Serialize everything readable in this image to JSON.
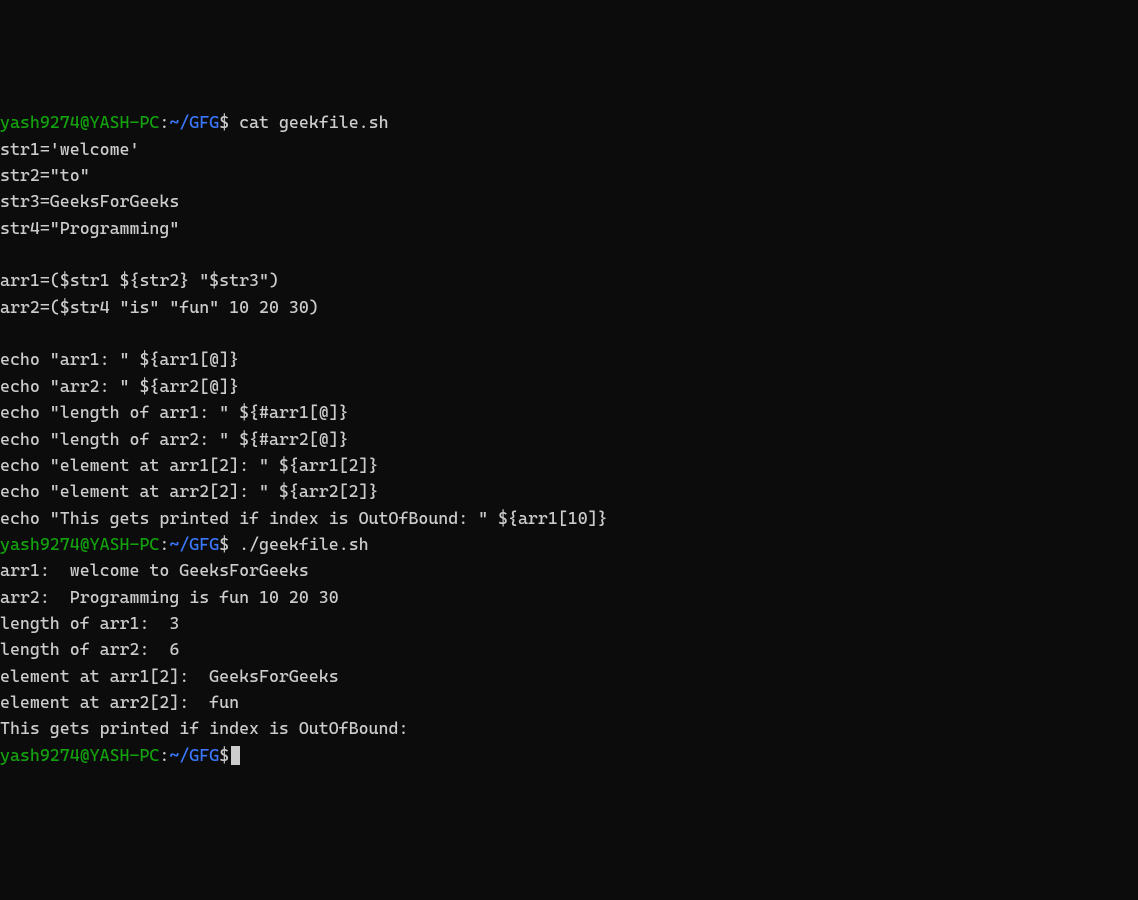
{
  "prompt": {
    "user": "yash9274",
    "at": "@",
    "host": "YASH-PC",
    "colon": ":",
    "tilde": "~",
    "slash": "/",
    "dir": "GFG",
    "dollar": "$"
  },
  "cmd1": "cat geekfile.sh",
  "file": {
    "l1": "str1='welcome'",
    "l2": "str2=\"to\"",
    "l3": "str3=GeeksForGeeks",
    "l4": "str4=\"Programming\"",
    "l5": "",
    "l6": "arr1=($str1 ${str2} \"$str3\")",
    "l7": "arr2=($str4 \"is\" \"fun\" 10 20 30)",
    "l8": "",
    "l9": "echo \"arr1: \" ${arr1[@]}",
    "l10": "echo \"arr2: \" ${arr2[@]}",
    "l11": "echo \"length of arr1: \" ${#arr1[@]}",
    "l12": "echo \"length of arr2: \" ${#arr2[@]}",
    "l13": "echo \"element at arr1[2]: \" ${arr1[2]}",
    "l14": "echo \"element at arr2[2]: \" ${arr2[2]}",
    "l15": "echo \"This gets printed if index is OutOfBound: \" ${arr1[10]}"
  },
  "cmd2": "./geekfile.sh",
  "out": {
    "l1": "arr1:  welcome to GeeksForGeeks",
    "l2": "arr2:  Programming is fun 10 20 30",
    "l3": "length of arr1:  3",
    "l4": "length of arr2:  6",
    "l5": "element at arr1[2]:  GeeksForGeeks",
    "l6": "element at arr2[2]:  fun",
    "l7": "This gets printed if index is OutOfBound:"
  }
}
